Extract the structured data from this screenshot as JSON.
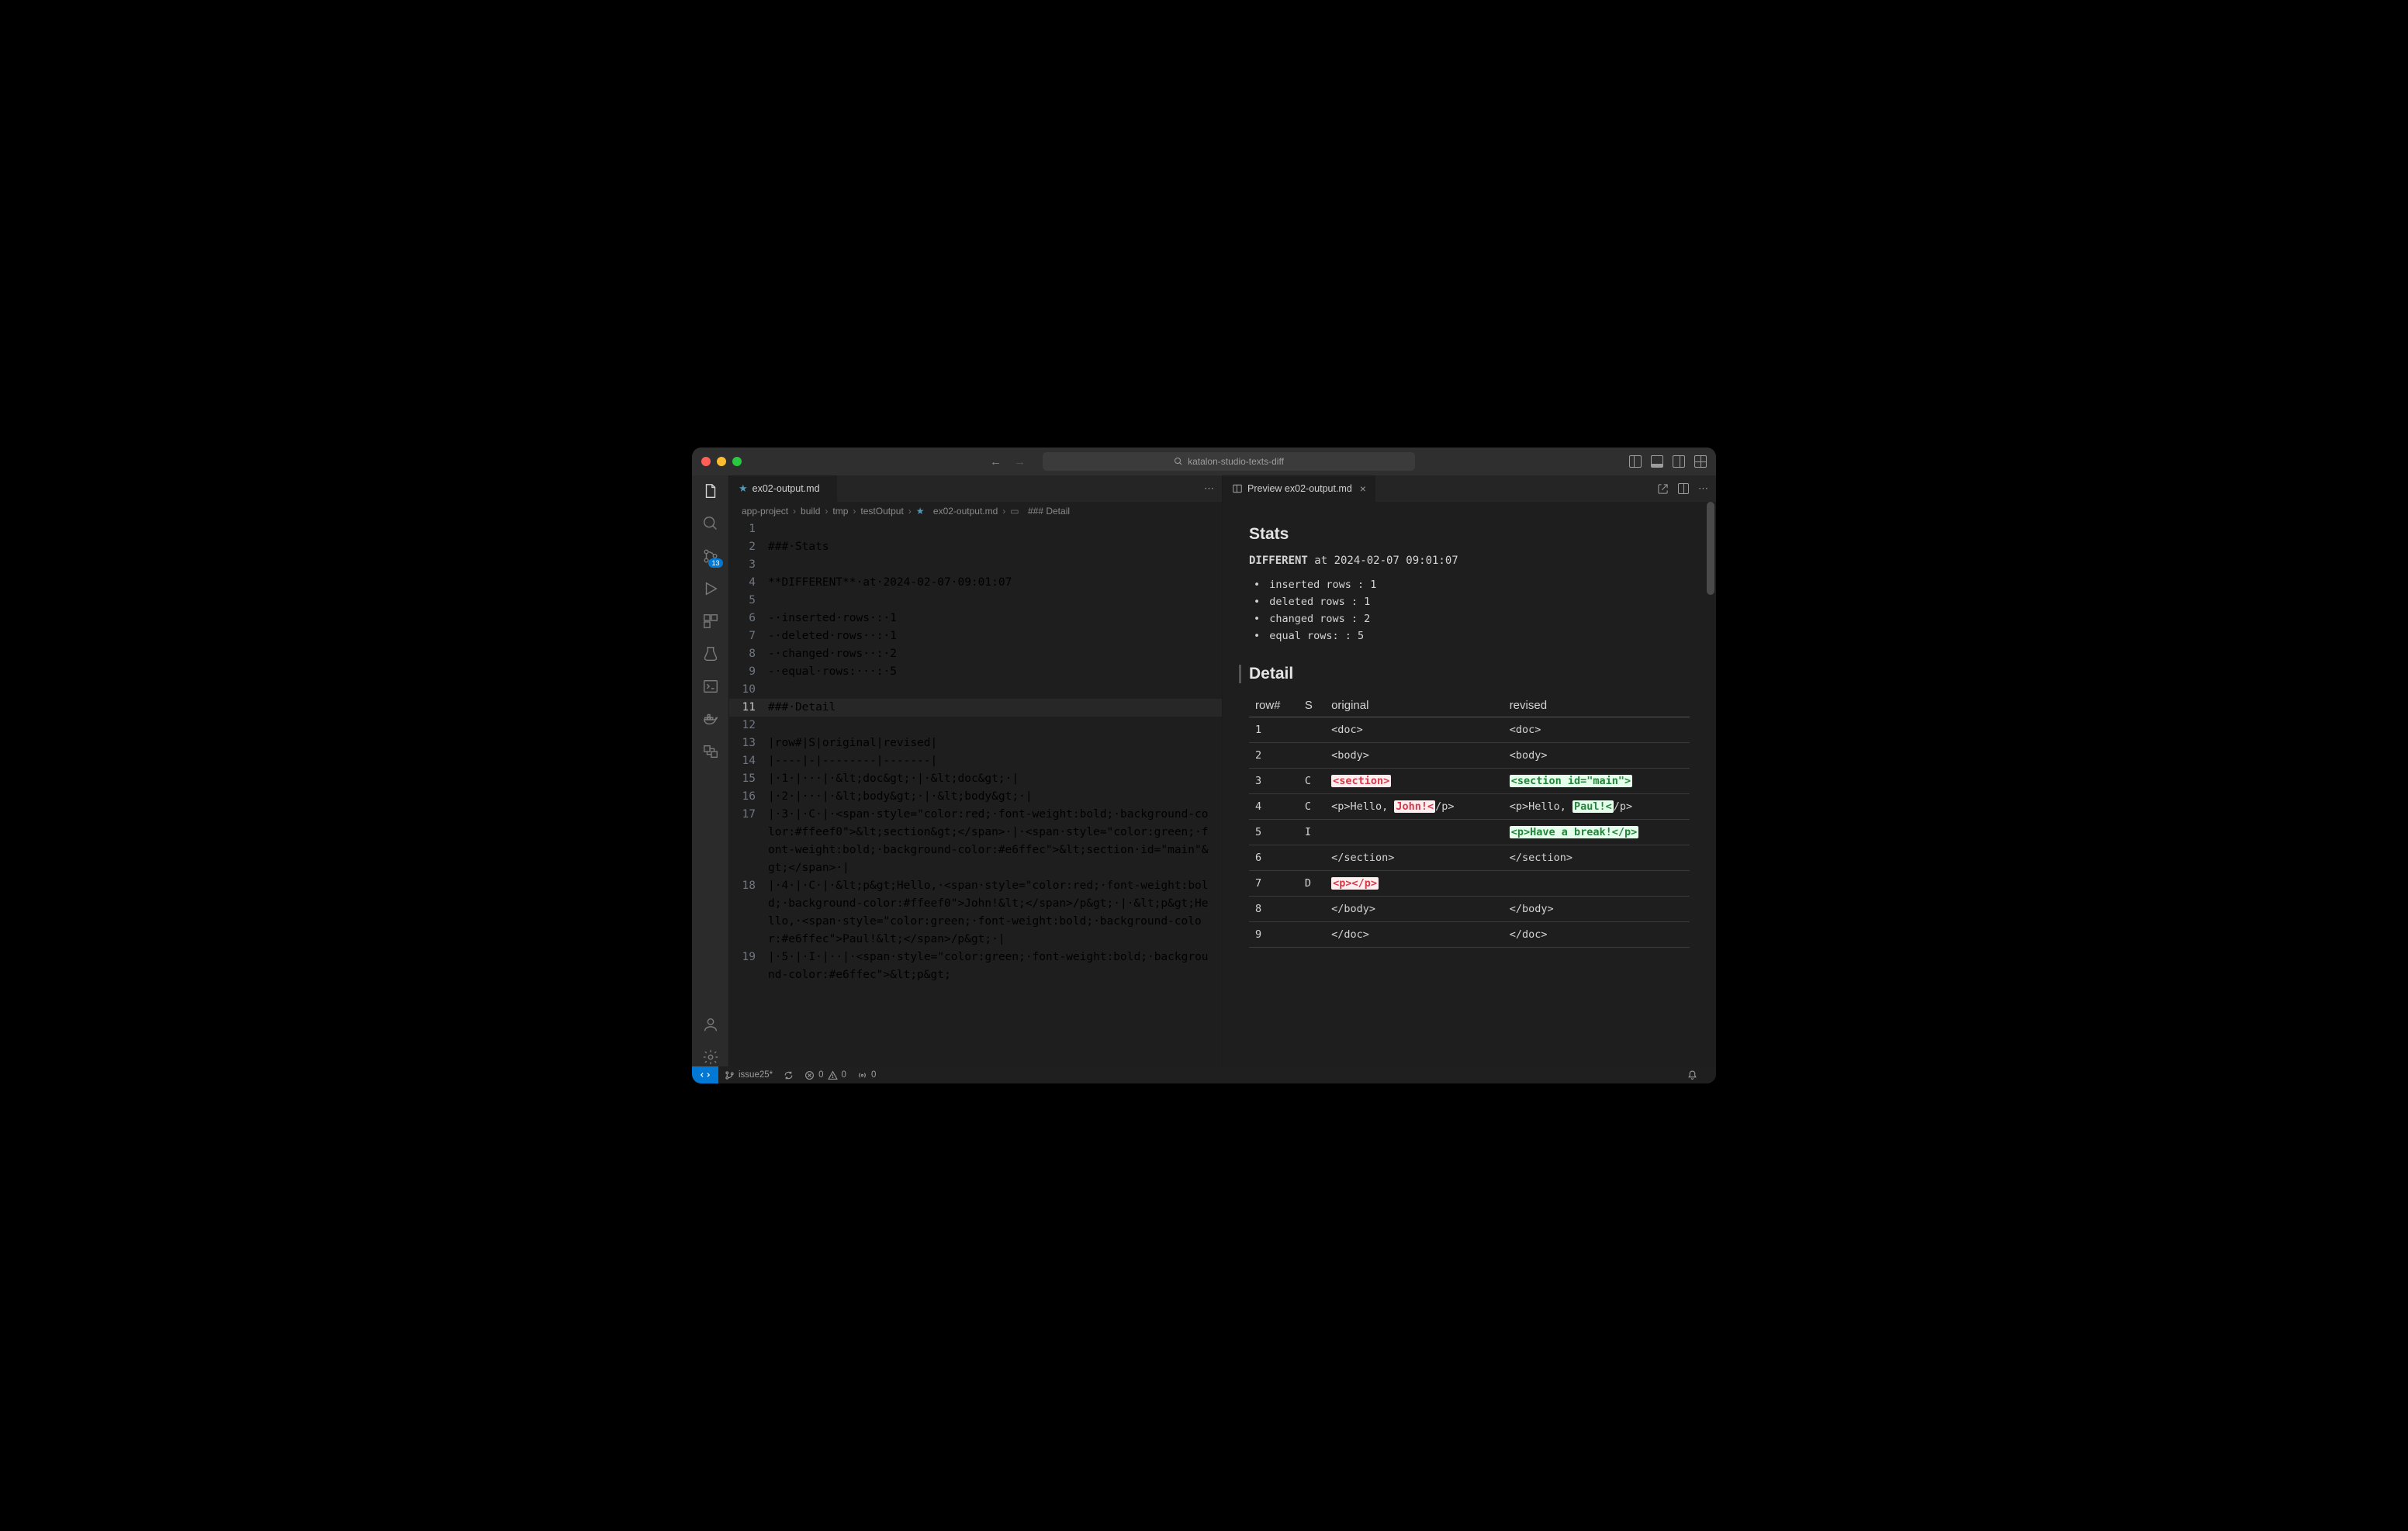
{
  "titlebar": {
    "search_text": "katalon-studio-texts-diff"
  },
  "activitybar": {
    "scm_badge": "13"
  },
  "editor_tab": {
    "filename": "ex02-output.md"
  },
  "breadcrumbs": {
    "seg1": "app-project",
    "seg2": "build",
    "seg3": "tmp",
    "seg4": "testOutput",
    "seg5": "ex02-output.md",
    "seg6": "### Detail"
  },
  "source_lines": [
    {
      "n": 1,
      "t": ""
    },
    {
      "n": 2,
      "t": "###·Stats",
      "cls": "h3"
    },
    {
      "n": 3,
      "t": ""
    },
    {
      "n": 4,
      "t": "**DIFFERENT**·at·2024-02-07·09:01:07",
      "bold": true
    },
    {
      "n": 5,
      "t": ""
    },
    {
      "n": 6,
      "t": "-·inserted·rows·:·1"
    },
    {
      "n": 7,
      "t": "-·deleted·rows··:·1"
    },
    {
      "n": 8,
      "t": "-·changed·rows··:·2"
    },
    {
      "n": 9,
      "t": "-·equal·rows:···:·5"
    },
    {
      "n": 10,
      "t": ""
    },
    {
      "n": 11,
      "t": "###·Detail",
      "cls": "h3",
      "current": true
    },
    {
      "n": 12,
      "t": ""
    },
    {
      "n": 13,
      "t": "|row#|S|original|revised|"
    },
    {
      "n": 14,
      "t": "|----|-|--------|-------|"
    },
    {
      "n": 15,
      "t": "|·1·|···|·&lt;doc&gt;·|·&lt;doc&gt;·|"
    },
    {
      "n": 16,
      "t": "|·2·|···|·&lt;body&gt;·|·&lt;body&gt;·|"
    },
    {
      "n": 17,
      "t": "|·3·|·C·|·<span·style=\"color:red;·font-weight:bold;·background-color:#ffeef0\">&lt;section&gt;</span>·|·<span·style=\"color:green;·font-weight:bold;·background-color:#e6ffec\">&lt;section·id=\"main\"&gt;</span>·|"
    },
    {
      "n": 18,
      "t": "|·4·|·C·|·&lt;p&gt;Hello,·<span·style=\"color:red;·font-weight:bold;·background-color:#ffeef0\">John!&lt;</span>/p&gt;·|·&lt;p&gt;Hello,·<span·style=\"color:green;·font-weight:bold;·background-color:#e6ffec\">Paul!&lt;</span>/p&gt;·|"
    },
    {
      "n": 19,
      "t": "|·5·|·I·|··|·<span·style=\"color:green;·font-weight:bold;·background-color:#e6ffec\">&lt;p&gt;"
    }
  ],
  "preview": {
    "tab_title": "Preview ex02-output.md",
    "stats_heading": "Stats",
    "status_word": "DIFFERENT",
    "status_rest": " at 2024-02-07 09:01:07",
    "bullets": [
      "inserted rows : 1",
      "deleted rows  : 1",
      "changed rows  : 2",
      "equal rows:   : 5"
    ],
    "detail_heading": "Detail",
    "headers": {
      "row": "row#",
      "s": "S",
      "orig": "original",
      "rev": "revised"
    },
    "rows": [
      {
        "n": "1",
        "s": "",
        "orig": [
          {
            "t": "<doc>"
          }
        ],
        "rev": [
          {
            "t": "<doc>"
          }
        ]
      },
      {
        "n": "2",
        "s": "",
        "orig": [
          {
            "t": "<body>"
          }
        ],
        "rev": [
          {
            "t": "<body>"
          }
        ]
      },
      {
        "n": "3",
        "s": "C",
        "orig": [
          {
            "t": "<section>",
            "c": "red"
          }
        ],
        "rev": [
          {
            "t": "<section id=\"main\">",
            "c": "green"
          }
        ]
      },
      {
        "n": "4",
        "s": "C",
        "orig": [
          {
            "t": "<p>Hello, "
          },
          {
            "t": "John!<",
            "c": "red"
          },
          {
            "t": "/p>"
          }
        ],
        "rev": [
          {
            "t": "<p>Hello, "
          },
          {
            "t": "Paul!<",
            "c": "green"
          },
          {
            "t": "/p>"
          }
        ]
      },
      {
        "n": "5",
        "s": "I",
        "orig": [],
        "rev": [
          {
            "t": "<p>Have a break!</p>",
            "c": "green"
          }
        ]
      },
      {
        "n": "6",
        "s": "",
        "orig": [
          {
            "t": "</section>"
          }
        ],
        "rev": [
          {
            "t": "</section>"
          }
        ]
      },
      {
        "n": "7",
        "s": "D",
        "orig": [
          {
            "t": "<p></p>",
            "c": "red"
          }
        ],
        "rev": []
      },
      {
        "n": "8",
        "s": "",
        "orig": [
          {
            "t": "</body>"
          }
        ],
        "rev": [
          {
            "t": "</body>"
          }
        ]
      },
      {
        "n": "9",
        "s": "",
        "orig": [
          {
            "t": "</doc>"
          }
        ],
        "rev": [
          {
            "t": "</doc>"
          }
        ]
      }
    ]
  },
  "statusbar": {
    "branch": "issue25*",
    "errors": "0",
    "warnings": "0",
    "ports": "0"
  }
}
